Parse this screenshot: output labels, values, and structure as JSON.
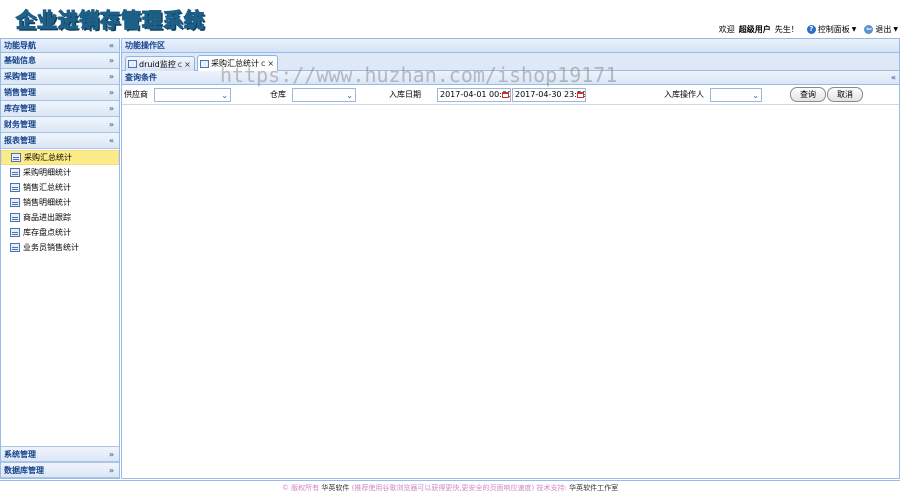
{
  "header": {
    "logo_text": "企业进销存管理系统",
    "welcome": "欢迎",
    "username": "超级用户",
    "greeting_suffix": "先生！",
    "control_panel": "控制面板",
    "logout": "退出"
  },
  "sidebar": {
    "title": "功能导航",
    "sections_top": [
      {
        "label": "基础信息"
      },
      {
        "label": "采购管理"
      },
      {
        "label": "销售管理"
      },
      {
        "label": "库存管理"
      },
      {
        "label": "财务管理"
      },
      {
        "label": "报表管理"
      }
    ],
    "report_items": [
      {
        "label": "采购汇总统计"
      },
      {
        "label": "采购明细统计"
      },
      {
        "label": "销售汇总统计"
      },
      {
        "label": "销售明细统计"
      },
      {
        "label": "商品进出跟踪"
      },
      {
        "label": "库存盘点统计"
      },
      {
        "label": "业务员销售统计"
      }
    ],
    "sections_bottom": [
      {
        "label": "系统管理"
      },
      {
        "label": "数据库管理"
      }
    ]
  },
  "main": {
    "title": "功能操作区",
    "tabs": [
      {
        "label": "druid监控"
      },
      {
        "label": "采购汇总统计"
      }
    ],
    "query": {
      "title": "查询条件",
      "supplier_label": "供应商",
      "warehouse_label": "仓库",
      "date_label": "入库日期",
      "date_start": "2017-04-01 00:00:",
      "date_end": "2017-04-30 23:59:",
      "operator_label": "入库操作人",
      "search_button": "查询",
      "cancel_button": "取消"
    }
  },
  "watermark": "https://www.huzhan.com/ishop19171",
  "footer": {
    "copyright": "© 版权所有",
    "company": "华英软件",
    "note": "(推荐使用谷歌浏览器可以获得更快,更安全的页面响应速度)",
    "support_label": "技术支持:",
    "support": "华英软件工作室"
  }
}
